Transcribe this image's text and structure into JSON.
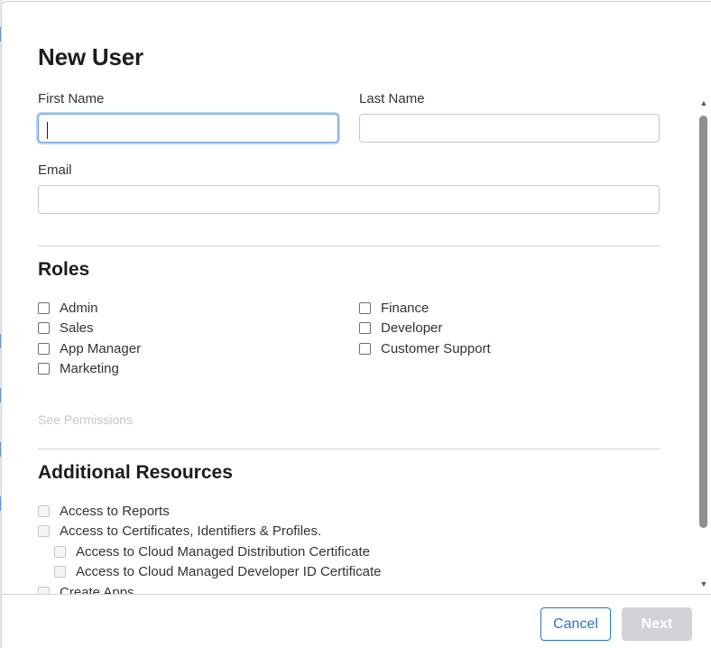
{
  "modal": {
    "title": "New User"
  },
  "form": {
    "first_name": {
      "label": "First Name",
      "value": ""
    },
    "last_name": {
      "label": "Last Name",
      "value": ""
    },
    "email": {
      "label": "Email",
      "value": ""
    }
  },
  "roles": {
    "title": "Roles",
    "left": [
      {
        "label": "Admin",
        "checked": false
      },
      {
        "label": "Sales",
        "checked": false
      },
      {
        "label": "App Manager",
        "checked": false
      },
      {
        "label": "Marketing",
        "checked": false
      }
    ],
    "right": [
      {
        "label": "Finance",
        "checked": false
      },
      {
        "label": "Developer",
        "checked": false
      },
      {
        "label": "Customer Support",
        "checked": false
      }
    ],
    "see_permissions": "See Permissions"
  },
  "resources": {
    "title": "Additional Resources",
    "items": [
      {
        "label": "Access to Reports",
        "checked": false,
        "disabled": true
      },
      {
        "label": "Access to Certificates, Identifiers & Profiles.",
        "checked": false,
        "disabled": true
      },
      {
        "label": "Access to Cloud Managed Distribution Certificate",
        "checked": false,
        "disabled": true
      },
      {
        "label": "Access to Cloud Managed Developer ID Certificate",
        "checked": false,
        "disabled": true
      },
      {
        "label": "Create Apps",
        "checked": false,
        "disabled": true
      }
    ]
  },
  "footer": {
    "cancel_label": "Cancel",
    "next_label": "Next"
  },
  "colors": {
    "accent": "#2a73c9",
    "disabled_text": "#c7c7cc",
    "focus_ring": "#b9d2f1"
  }
}
